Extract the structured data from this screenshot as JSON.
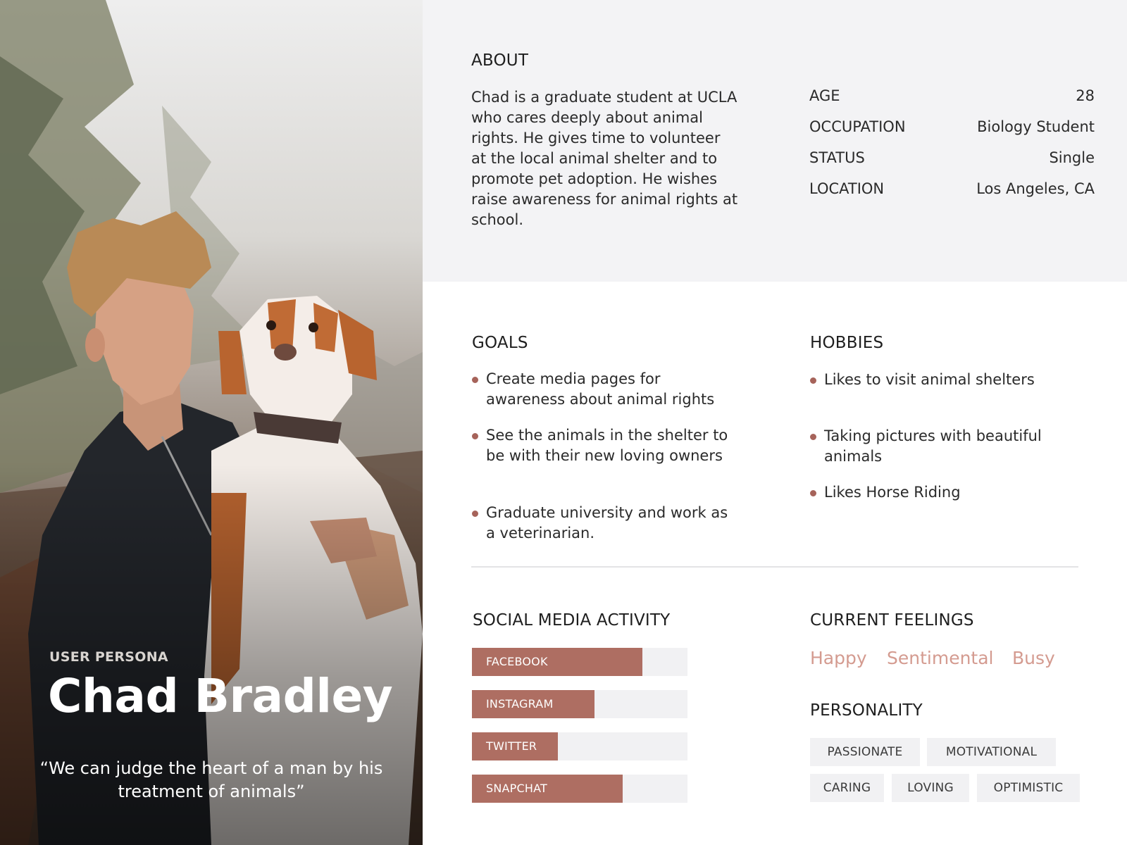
{
  "persona": {
    "kicker": "USER PERSONA",
    "name": "Chad Bradley",
    "quote": "“We can judge the heart of a man by his treatment of animals”"
  },
  "about": {
    "heading": "ABOUT",
    "text": "Chad is a graduate student at UCLA who cares deeply about animal rights. He gives time to volunteer at the local animal shelter and to promote pet adoption. He wishes raise awareness for animal rights at school."
  },
  "demographics": [
    {
      "label": "AGE",
      "value": "28"
    },
    {
      "label": "OCCUPATION",
      "value": "Biology Student"
    },
    {
      "label": "STATUS",
      "value": "Single"
    },
    {
      "label": "LOCATION",
      "value": "Los Angeles, CA"
    }
  ],
  "goals": {
    "heading": "GOALS",
    "items": [
      "Create media pages for awareness about animal rights",
      "See the animals in the shelter to be with their new loving owners",
      "Graduate university and work as a veterinarian."
    ]
  },
  "hobbies": {
    "heading": "HOBBIES",
    "items": [
      "Likes to visit animal shelters",
      "Taking pictures with beautiful animals",
      "Likes Horse Riding"
    ]
  },
  "social": {
    "heading": "SOCIAL MEDIA ACTIVITY",
    "bars": [
      {
        "label": "FACEBOOK",
        "level": 0.79
      },
      {
        "label": "INSTAGRAM",
        "level": 0.57
      },
      {
        "label": "TWITTER",
        "level": 0.4
      },
      {
        "label": "SNAPCHAT",
        "level": 0.7
      }
    ]
  },
  "feelings": {
    "heading": "CURRENT FEELINGS",
    "items": [
      "Happy",
      "Sentimental",
      "Busy"
    ]
  },
  "personality": {
    "heading": "PERSONALITY",
    "tags": [
      "PASSIONATE",
      "MOTIVATIONAL",
      "CARING",
      "LOVING",
      "OPTIMISTIC"
    ]
  },
  "colors": {
    "accent": "#ae6e62",
    "feeling_text": "#d49b90",
    "about_background": "#f3f3f5",
    "tag_background": "#f1f1f3"
  }
}
